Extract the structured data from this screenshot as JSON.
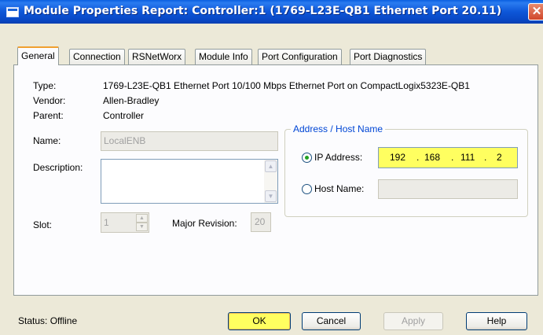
{
  "window": {
    "title": "Module Properties Report: Controller:1 (1769-L23E-QB1 Ethernet Port 20.11)",
    "close_glyph": "✕"
  },
  "tabs": [
    {
      "label": "General",
      "active": true
    },
    {
      "label": "Connection"
    },
    {
      "label": "RSNetWorx"
    },
    {
      "label": "Module Info"
    },
    {
      "label": "Port Configuration"
    },
    {
      "label": "Port Diagnostics"
    }
  ],
  "general": {
    "type_label": "Type:",
    "type_value": "1769-L23E-QB1 Ethernet Port 10/100 Mbps Ethernet Port on CompactLogix5323E-QB1",
    "vendor_label": "Vendor:",
    "vendor_value": "Allen-Bradley",
    "parent_label": "Parent:",
    "parent_value": "Controller",
    "name_label": "Name:",
    "name_value": "LocalENB",
    "description_label": "Description:",
    "description_value": "",
    "slot_label": "Slot:",
    "slot_value": "1",
    "major_revision_label": "Major Revision:",
    "major_revision_value": "20"
  },
  "address": {
    "group_title": "Address / Host Name",
    "ip_label": "IP Address:",
    "ip_octets": [
      "192",
      "168",
      "111",
      "2"
    ],
    "ip_selected": true,
    "host_label": "Host Name:",
    "host_value": ""
  },
  "footer": {
    "status": "Status:  Offline",
    "ok_label": "OK",
    "cancel_label": "Cancel",
    "apply_label": "Apply",
    "help_label": "Help"
  },
  "colors": {
    "highlight": "#ffff60",
    "title_bar": "#0d56d8",
    "group_title": "#0046d5"
  }
}
